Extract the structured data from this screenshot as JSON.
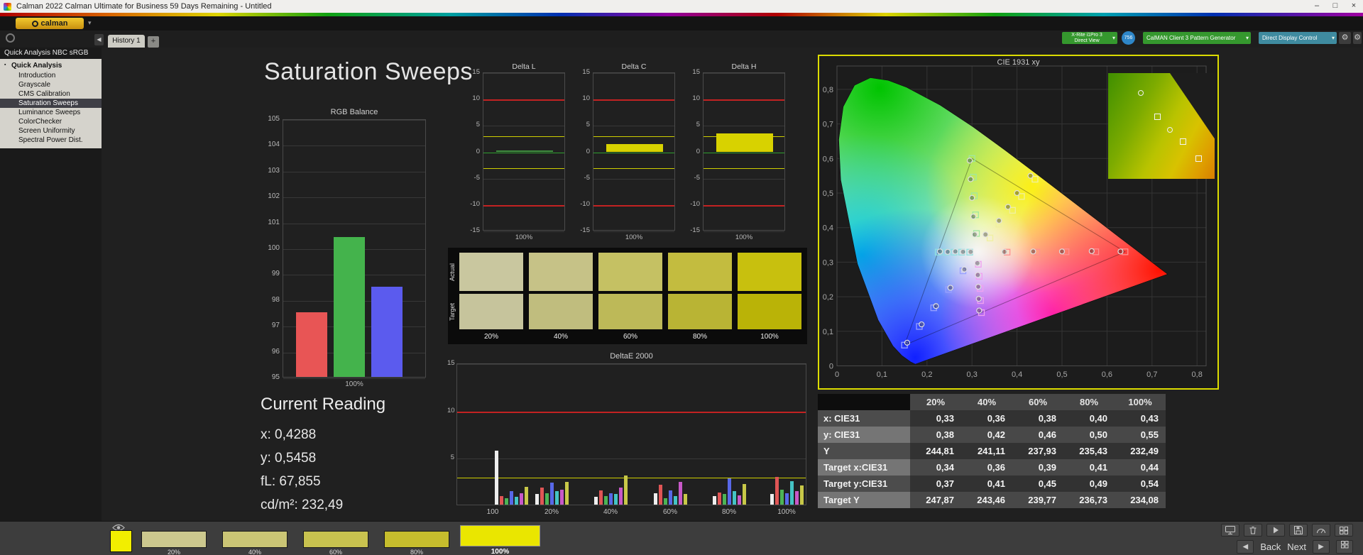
{
  "window": {
    "title": "Calman 2022 Calman Ultimate for Business 59 Days Remaining - Untitled",
    "controls": {
      "minimize": "–",
      "maximize": "□",
      "close": "×"
    }
  },
  "brand": {
    "logo_text": "calman"
  },
  "theme": {
    "cie_border": "#dcdc00",
    "limit_red": "#c32222",
    "limit_yellow": "#cfcf00",
    "zero_green": "#2f9f2f",
    "selection_bg": "#3f3f46",
    "meter_green": "#35982e",
    "display_blue": "#3f8ba0",
    "badge_blue": "#2e86c8"
  },
  "toolbar": {
    "history_tab": "History 1",
    "add_tab": "+",
    "meter_button": {
      "line1": "X-Rite i1Pro 3",
      "line2": "Direct View"
    },
    "meter_badge": "756",
    "generator_button": {
      "label": "CalMAN Client 3 Pattern Generator"
    },
    "display_button": {
      "label": "Direct Display Control"
    }
  },
  "sidebar": {
    "header": "Quick Analysis NBC sRGB",
    "root_item": "Quick Analysis",
    "items": [
      "Introduction",
      "Grayscale",
      "CMS Calibration",
      "Saturation Sweeps",
      "Luminance Sweeps",
      "ColorChecker",
      "Screen Uniformity",
      "Spectral Power Dist."
    ],
    "selected_index": 3
  },
  "page": {
    "title": "Saturation Sweeps"
  },
  "current_reading": {
    "title": "Current Reading",
    "x": "x: 0,4288",
    "y": "y: 0,5458",
    "fl": "fL: 67,855",
    "cdm2": "cd/m²: 232,49"
  },
  "swatch_panel": {
    "row_labels": [
      "Actual",
      "Target"
    ],
    "labels": [
      "20%",
      "40%",
      "60%",
      "80%",
      "100%"
    ],
    "actual_colors": [
      "#c9c79f",
      "#c6c287",
      "#c5c163",
      "#c3bc3f",
      "#c8c00e"
    ],
    "target_colors": [
      "#c6c49c",
      "#c0bd7e",
      "#bdb958",
      "#b9b434",
      "#bab307"
    ]
  },
  "table": {
    "columns": [
      "20%",
      "40%",
      "60%",
      "80%",
      "100%"
    ],
    "rows": [
      {
        "label": "x: CIE31",
        "values": [
          "0,33",
          "0,36",
          "0,38",
          "0,40",
          "0,43"
        ]
      },
      {
        "label": "y: CIE31",
        "values": [
          "0,38",
          "0,42",
          "0,46",
          "0,50",
          "0,55"
        ]
      },
      {
        "label": "Y",
        "values": [
          "244,81",
          "241,11",
          "237,93",
          "235,43",
          "232,49"
        ]
      },
      {
        "label": "Target x:CIE31",
        "values": [
          "0,34",
          "0,36",
          "0,39",
          "0,41",
          "0,44"
        ]
      },
      {
        "label": "Target y:CIE31",
        "values": [
          "0,37",
          "0,41",
          "0,45",
          "0,49",
          "0,54"
        ]
      },
      {
        "label": "Target Y",
        "values": [
          "247,87",
          "243,46",
          "239,77",
          "236,73",
          "234,08"
        ]
      }
    ]
  },
  "filmstrip": {
    "preview_color": "#f2ee00",
    "thumbs": [
      {
        "label": "20%",
        "color": "#ccc88e",
        "selected": false
      },
      {
        "label": "40%",
        "color": "#cac575",
        "selected": false
      },
      {
        "label": "60%",
        "color": "#c8c24f",
        "selected": false
      },
      {
        "label": "80%",
        "color": "#c6bd2d",
        "selected": false
      },
      {
        "label": "100%",
        "color": "#eae600",
        "selected": true
      }
    ]
  },
  "nav": {
    "back": "Back",
    "next": "Next"
  },
  "chart_data": {
    "rgb_balance": {
      "type": "bar",
      "title": "RGB Balance",
      "xlabel": "100%",
      "ylim": [
        95,
        105
      ],
      "yticks": [
        105,
        104,
        103,
        102,
        101,
        100,
        99,
        98,
        97,
        96,
        95
      ],
      "series": [
        {
          "name": "red",
          "value": 97.5,
          "color": "#e85555"
        },
        {
          "name": "green",
          "value": 100.4,
          "color": "#44b34c"
        },
        {
          "name": "blue",
          "value": 98.5,
          "color": "#5b5bee"
        }
      ]
    },
    "delta_axis": {
      "ylim": [
        -15,
        15
      ],
      "yticks": [
        15,
        10,
        5,
        0,
        -5,
        -10,
        -15
      ],
      "red_limit": 10,
      "yellow_limit": 3
    },
    "delta_charts": [
      {
        "type": "bar",
        "title": "Delta L",
        "xlabel": "100%",
        "value": 0.4,
        "bar_color": "#3f8f3f"
      },
      {
        "type": "bar",
        "title": "Delta C",
        "xlabel": "100%",
        "value": 1.5,
        "bar_color": "#d8d200"
      },
      {
        "type": "bar",
        "title": "Delta H",
        "xlabel": "100%",
        "value": 3.6,
        "bar_color": "#d8d200"
      }
    ],
    "deltae_2000": {
      "type": "bar",
      "title": "DeltaE 2000",
      "ylim": [
        0,
        15
      ],
      "yticks": [
        15,
        10,
        5
      ],
      "red_limit": 10,
      "yellow_limit": 3,
      "group_labels": [
        "100",
        "20%",
        "40%",
        "60%",
        "80%",
        "100%"
      ],
      "bar_colors": [
        "#eeeeee",
        "#e05555",
        "#4cb455",
        "#5868e8",
        "#44c4c4",
        "#c858c8",
        "#c8c848"
      ],
      "groups": [
        [
          5.7,
          0.9,
          0.7,
          1.4,
          0.8,
          1.2,
          1.9
        ],
        [
          1.1,
          1.8,
          1.2,
          2.3,
          1.4,
          1.6,
          2.4
        ],
        [
          0.8,
          1.5,
          0.9,
          1.2,
          1.1,
          1.8,
          3.1
        ],
        [
          1.2,
          2.1,
          0.7,
          1.5,
          0.9,
          2.4,
          1.1
        ],
        [
          0.9,
          1.3,
          1.1,
          2.8,
          1.4,
          1.0,
          2.2
        ],
        [
          1.1,
          2.9,
          1.6,
          1.2,
          2.5,
          1.4,
          2.0
        ]
      ]
    },
    "cie_1931": {
      "type": "scatter",
      "title": "CIE 1931 xy",
      "xlim": [
        0,
        0.8
      ],
      "ylim": [
        0,
        0.8
      ],
      "tick_labels": [
        "0",
        "0,1",
        "0,2",
        "0,3",
        "0,4",
        "0,5",
        "0,6",
        "0,7",
        "0,8"
      ],
      "white_point": [
        0.3127,
        0.329
      ],
      "sweeps": [
        {
          "name": "red",
          "marker_color": "#ff9090",
          "targets": [
            [
              0.378,
              0.329
            ],
            [
              0.444,
              0.329
            ],
            [
              0.509,
              0.33
            ],
            [
              0.575,
              0.33
            ],
            [
              0.64,
              0.33
            ]
          ],
          "measured": [
            [
              0.372,
              0.33
            ],
            [
              0.436,
              0.331
            ],
            [
              0.5,
              0.331
            ],
            [
              0.566,
              0.332
            ],
            [
              0.63,
              0.331
            ]
          ]
        },
        {
          "name": "green",
          "marker_color": "#a0e8a0",
          "targets": [
            [
              0.31,
              0.383
            ],
            [
              0.308,
              0.437
            ],
            [
              0.305,
              0.492
            ],
            [
              0.303,
              0.546
            ],
            [
              0.3,
              0.6
            ]
          ],
          "measured": [
            [
              0.306,
              0.38
            ],
            [
              0.303,
              0.432
            ],
            [
              0.3,
              0.486
            ],
            [
              0.297,
              0.54
            ],
            [
              0.295,
              0.594
            ]
          ]
        },
        {
          "name": "blue",
          "marker_color": "#98a0ff",
          "targets": [
            [
              0.28,
              0.275
            ],
            [
              0.248,
              0.221
            ],
            [
              0.215,
              0.168
            ],
            [
              0.183,
              0.114
            ],
            [
              0.15,
              0.06
            ]
          ],
          "measured": [
            [
              0.283,
              0.279
            ],
            [
              0.252,
              0.226
            ],
            [
              0.22,
              0.173
            ],
            [
              0.188,
              0.12
            ],
            [
              0.156,
              0.067
            ]
          ]
        },
        {
          "name": "cyan",
          "marker_color": "#90e0e0",
          "targets": [
            [
              0.295,
              0.329
            ],
            [
              0.277,
              0.329
            ],
            [
              0.26,
              0.329
            ],
            [
              0.242,
              0.329
            ],
            [
              0.225,
              0.329
            ]
          ],
          "measured": [
            [
              0.297,
              0.33
            ],
            [
              0.28,
              0.33
            ],
            [
              0.263,
              0.331
            ],
            [
              0.246,
              0.33
            ],
            [
              0.229,
              0.331
            ]
          ]
        },
        {
          "name": "magenta",
          "marker_color": "#f0a0f0",
          "targets": [
            [
              0.314,
              0.294
            ],
            [
              0.316,
              0.259
            ],
            [
              0.318,
              0.224
            ],
            [
              0.319,
              0.189
            ],
            [
              0.321,
              0.154
            ]
          ],
          "measured": [
            [
              0.312,
              0.297
            ],
            [
              0.313,
              0.263
            ],
            [
              0.314,
              0.229
            ],
            [
              0.315,
              0.194
            ],
            [
              0.316,
              0.16
            ]
          ]
        },
        {
          "name": "yellow",
          "marker_color": "#f0f0a0",
          "targets": [
            [
              0.34,
              0.37
            ],
            [
              0.36,
              0.41
            ],
            [
              0.39,
              0.45
            ],
            [
              0.41,
              0.49
            ],
            [
              0.44,
              0.54
            ]
          ],
          "measured": [
            [
              0.33,
              0.38
            ],
            [
              0.36,
              0.42
            ],
            [
              0.38,
              0.46
            ],
            [
              0.4,
              0.5
            ],
            [
              0.43,
              0.55
            ]
          ]
        }
      ]
    }
  }
}
